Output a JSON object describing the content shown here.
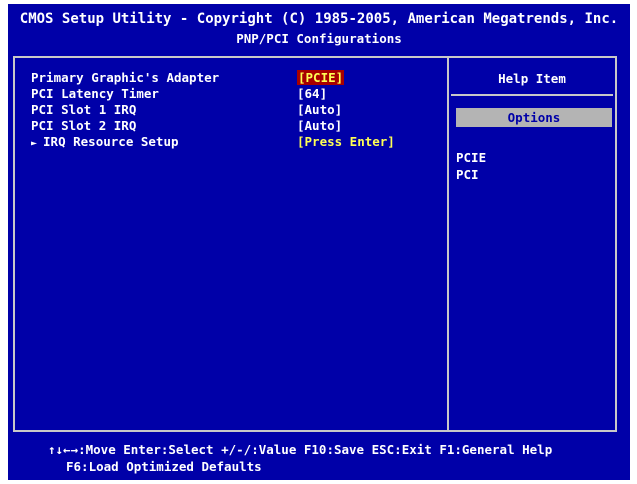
{
  "header": {
    "title": "CMOS Setup Utility - Copyright (C) 1985-2005, American Megatrends, Inc.",
    "subtitle": "PNP/PCI Configurations"
  },
  "settings": [
    {
      "label": "Primary Graphic's Adapter",
      "value": "[PCIE]",
      "selected": true
    },
    {
      "label": "PCI Latency Timer",
      "value": "[64]"
    },
    {
      "label": "PCI Slot 1 IRQ",
      "value": "[Auto]"
    },
    {
      "label": "PCI Slot 2 IRQ",
      "value": "[Auto]"
    },
    {
      "label": "IRQ Resource Setup",
      "value": "[Press Enter]",
      "submenu": true
    }
  ],
  "help": {
    "title": "Help Item",
    "options_header": "Options",
    "options": [
      "PCIE",
      "PCI"
    ]
  },
  "footer": {
    "line1": "↑↓←→:Move  Enter:Select  +/-/:Value  F10:Save  ESC:Exit  F1:General Help",
    "line2": "F6:Load Optimized Defaults"
  },
  "colors": {
    "background": "#0000a8",
    "text": "#ffffff",
    "highlight_bg": "#a80000",
    "highlight_text": "#ffff54",
    "border": "#c8c8c8",
    "options_bar": "#b4b4b4"
  }
}
